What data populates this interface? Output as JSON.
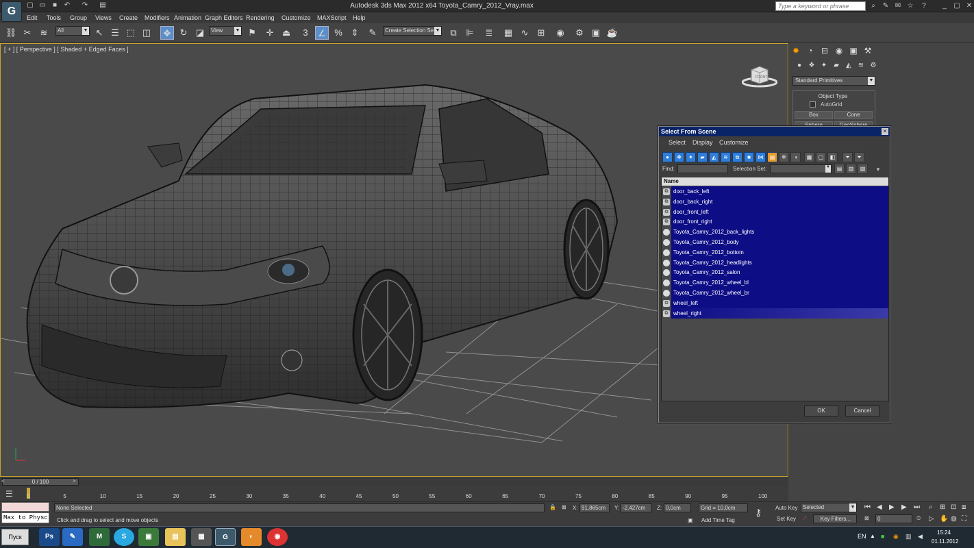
{
  "window": {
    "title": "Autodesk 3ds Max  2012 x64     Toyota_Camry_2012_Vray.max"
  },
  "search": {
    "placeholder": "Type a keyword or phrase"
  },
  "menu": [
    "Edit",
    "Tools",
    "Group",
    "Views",
    "Create",
    "Modifiers",
    "Animation",
    "Graph Editors",
    "Rendering",
    "Customize",
    "MAXScript",
    "Help"
  ],
  "toolbar": {
    "filter": "All",
    "ref_coord": "View",
    "snap_label": "3",
    "selection_set": "Create Selection Se"
  },
  "viewport": {
    "label": "[ + ] [ Perspective ] [ Shaded + Edged Faces ]",
    "viewcube_label": "FRONT"
  },
  "command_panel": {
    "category": "Standard Primitives",
    "rollout": "Object Type",
    "autogrid": "AutoGrid",
    "buttons": [
      "Box",
      "Cone",
      "Sphere",
      "GeoSphere"
    ]
  },
  "dialog": {
    "title": "Select From Scene",
    "menu": [
      "Select",
      "Display",
      "Customize"
    ],
    "find_label": "Find:",
    "selection_set_label": "Selection Set:",
    "column": "Name",
    "items": [
      "door_back_left",
      "door_back_right",
      "door_front_left",
      "door_front_right",
      "Toyota_Camry_2012_back_lights",
      "Toyota_Camry_2012_body",
      "Toyota_Camry_2012_bottom",
      "Toyota_Camry_2012_headlights",
      "Toyota_Camry_2012_salon",
      "Toyota_Camry_2012_wheel_bl",
      "Toyota_Camry_2012_wheel_br",
      "wheel_left",
      "wheel_right"
    ],
    "item_types": [
      "group",
      "group",
      "group",
      "group",
      "geo",
      "geo",
      "geo",
      "geo",
      "geo",
      "geo",
      "geo",
      "group",
      "group"
    ],
    "ok": "OK",
    "cancel": "Cancel"
  },
  "timeline": {
    "frame": "0 / 100",
    "ticks": [
      "0",
      "5",
      "10",
      "15",
      "20",
      "25",
      "30",
      "35",
      "40",
      "45",
      "50",
      "55",
      "60",
      "65",
      "70",
      "75",
      "80",
      "85",
      "90",
      "95",
      "100"
    ]
  },
  "status": {
    "listener": "Max to Physc",
    "selection": "None Selected",
    "prompt": "Click and drag to select and move objects",
    "x_label": "X:",
    "x": "91,865cm",
    "y_label": "Y:",
    "y": "-2,427cm",
    "z_label": "Z:",
    "z": "0,0cm",
    "grid": "Grid = 10,0cm",
    "add_time_tag": "Add Time Tag",
    "auto_key": "Auto Key",
    "set_key": "Set Key",
    "key_mode": "Selected",
    "key_filters": "Key Filters...",
    "current_frame": "0"
  },
  "taskbar": {
    "start": "Пуск",
    "lang": "EN",
    "time": "15:24",
    "date": "01.11.2012"
  }
}
